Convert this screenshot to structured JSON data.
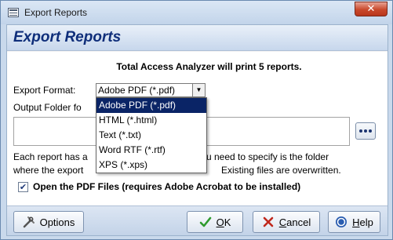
{
  "window": {
    "title": "Export Reports",
    "close_glyph": "✕"
  },
  "heading": "Export Reports",
  "intro": "Total Access Analyzer will print 5 reports.",
  "format": {
    "label": "Export Format:",
    "selected": "Adobe PDF (*.pdf)",
    "arrow": "▼",
    "options": [
      "Adobe PDF (*.pdf)",
      "HTML (*.html)",
      "Text (*.txt)",
      "Word RTF (*.rtf)",
      "XPS (*.xps)"
    ]
  },
  "output_folder": {
    "label_visible": "Output Folder fo",
    "value": ""
  },
  "description": {
    "line1_left": "Each report has a",
    "line1_right": "u need to specify is the folder",
    "line2_left": "where the export",
    "line2_right": "Existing files are overwritten."
  },
  "open_pdf": {
    "checked": true,
    "check_glyph": "✔",
    "label": "Open the PDF Files (requires Adobe Acrobat to be installed)"
  },
  "buttons": {
    "options": {
      "label": "Options",
      "icon": "tools-icon"
    },
    "ok": {
      "label_u": "O",
      "label_rest": "K",
      "icon": "checkmark-icon"
    },
    "cancel": {
      "label_u": "C",
      "label_rest": "ancel",
      "icon": "x-icon"
    },
    "help": {
      "label_u": "H",
      "label_rest": "elp",
      "icon": "help-icon"
    }
  },
  "colors": {
    "heading": "#0f2e7a",
    "selected_option_bg": "#0a2466",
    "ok_check": "#2e9a2e",
    "cancel_x": "#c0281c",
    "help_icon": "#2a5db0"
  }
}
